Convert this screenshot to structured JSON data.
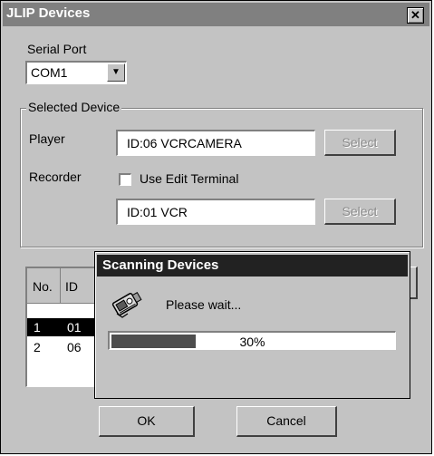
{
  "window": {
    "title": "JLIP Devices",
    "close_glyph": "✕"
  },
  "serial_port": {
    "label": "Serial Port",
    "selected": "COM1",
    "arrow": "▼"
  },
  "selected_device": {
    "group_label": "Selected Device",
    "player_label": "Player",
    "player_value": "ID:06 VCRCAMERA",
    "recorder_label": "Recorder",
    "edit_terminal_label": "Use Edit Terminal",
    "edit_terminal_checked": false,
    "recorder_value": "ID:01 VCR",
    "select_label": "Select"
  },
  "device_list": {
    "columns": [
      "No.",
      "ID"
    ],
    "rows": [
      {
        "no": "1",
        "id": "01",
        "selected": true
      },
      {
        "no": "2",
        "id": "06",
        "selected": false
      }
    ]
  },
  "buttons": {
    "ok": "OK",
    "cancel": "Cancel"
  },
  "scanning_dialog": {
    "title": "Scanning Devices",
    "message": "Please wait...",
    "icon": "camcorder-icon",
    "progress": 0.3,
    "progress_text": "30%"
  }
}
